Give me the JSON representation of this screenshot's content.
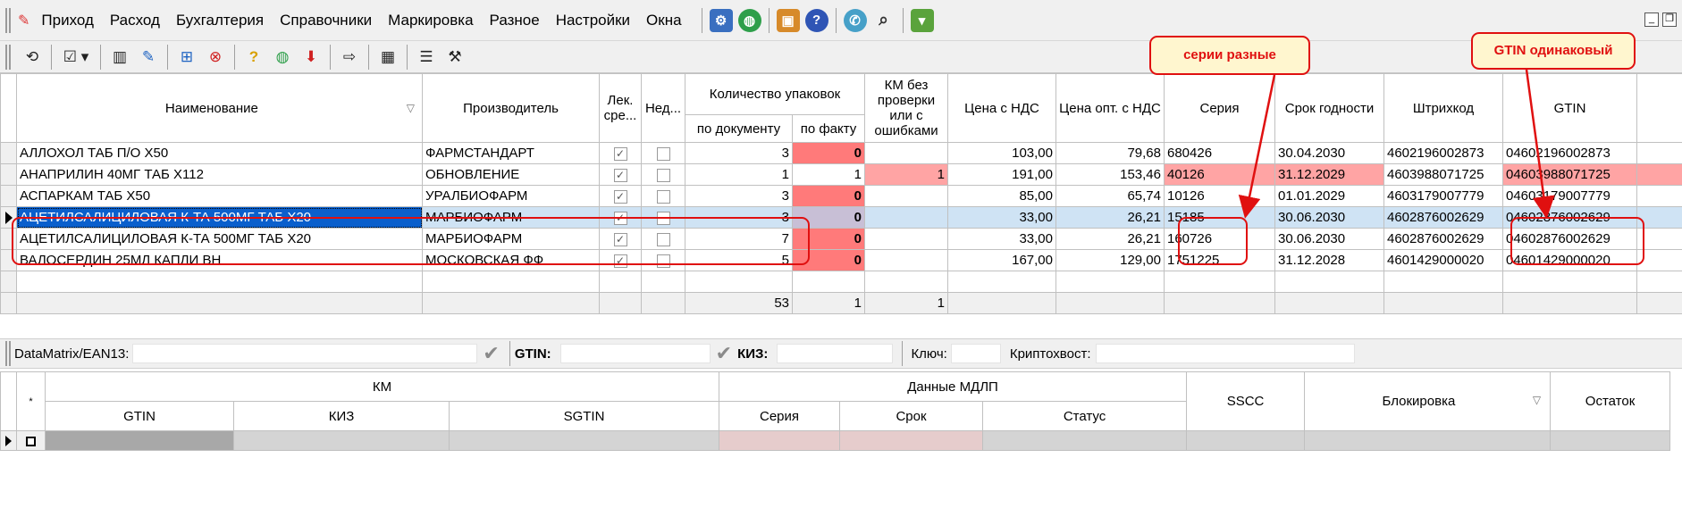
{
  "menu": [
    "Приход",
    "Расход",
    "Бухгалтерия",
    "Справочники",
    "Маркировка",
    "Разное",
    "Настройки",
    "Окна"
  ],
  "menu_icons": [
    "settings-icon",
    "globe-icon",
    "package-icon",
    "help-icon",
    "phone-icon",
    "magnifier-icon",
    "basket-icon"
  ],
  "toolbar_icons": [
    "refresh-icon",
    "checkbox-dropdown-icon",
    "barcode-icon",
    "edit-icon",
    "tree-add-icon",
    "cancel-icon",
    "question-icon",
    "globe-icon",
    "arrow-down-icon",
    "export-icon",
    "qr-icon",
    "list-icon",
    "tools-icon"
  ],
  "grid": {
    "headers": {
      "name": "Наименование",
      "maker": "Производитель",
      "lek": "Лек. сре...",
      "ned": "Нед...",
      "qty_group": "Количество упаковок",
      "qty_doc": "по документу",
      "qty_fact": "по факту",
      "km_unchecked": "КМ без проверки или с ошибками",
      "price_vat": "Цена с НДС",
      "price_wholesale": "Цена опт. с НДС",
      "series": "Серия",
      "expiry": "Срок годности",
      "barcode": "Штрихкод",
      "gtin": "GTIN"
    },
    "rows": [
      {
        "name": "АЛЛОХОЛ ТАБ П/О Х50",
        "maker": "ФАРМСТАНДАРТ",
        "doc": "3",
        "fact": "0",
        "km": "",
        "price": "103,00",
        "opt": "79,68",
        "series": "680426",
        "expiry": "30.04.2030",
        "barcode": "4602196002873",
        "gtin": "04602196002873"
      },
      {
        "name": "АНАПРИЛИН 40МГ ТАБ Х112",
        "maker": "ОБНОВЛЕНИЕ",
        "doc": "1",
        "fact": "1",
        "km": "1",
        "price": "191,00",
        "opt": "153,46",
        "series": "40126",
        "expiry": "31.12.2029",
        "barcode": "4603988071725",
        "gtin": "04603988071725"
      },
      {
        "name": "АСПАРКАМ ТАБ Х50",
        "maker": "УРАЛБИОФАРМ",
        "doc": "3",
        "fact": "0",
        "km": "",
        "price": "85,00",
        "opt": "65,74",
        "series": "10126",
        "expiry": "01.01.2029",
        "barcode": "4603179007779",
        "gtin": "04603179007779"
      },
      {
        "name": "АЦЕТИЛСАЛИЦИЛОВАЯ К-ТА 500МГ ТАБ Х20",
        "maker": "МАРБИОФАРМ",
        "doc": "3",
        "fact": "0",
        "km": "",
        "price": "33,00",
        "opt": "26,21",
        "series": "15185",
        "expiry": "30.06.2030",
        "barcode": "4602876002629",
        "gtin": "04602876002629"
      },
      {
        "name": "АЦЕТИЛСАЛИЦИЛОВАЯ К-ТА 500МГ ТАБ Х20",
        "maker": "МАРБИОФАРМ",
        "doc": "7",
        "fact": "0",
        "km": "",
        "price": "33,00",
        "opt": "26,21",
        "series": "160726",
        "expiry": "30.06.2030",
        "barcode": "4602876002629",
        "gtin": "04602876002629"
      },
      {
        "name": "ВАЛОСЕРДИН 25МЛ КАПЛИ ВН",
        "maker": "МОСКОВСКАЯ ФФ",
        "doc": "5",
        "fact": "0",
        "km": "",
        "price": "167,00",
        "opt": "129,00",
        "series": "1751225",
        "expiry": "31.12.2028",
        "barcode": "4601429000020",
        "gtin": "04601429000020"
      }
    ],
    "totals": {
      "doc": "53",
      "fact": "1",
      "km": "1"
    }
  },
  "filter": {
    "dm_label": "DataMatrix/EAN13:",
    "gtin_label": "GTIN:",
    "kiz_label": "КИЗ:",
    "key_label": "Ключ:",
    "crypto_label": "Криптохвост:"
  },
  "grid2": {
    "star": "*",
    "km_group": "КМ",
    "mdlp_group": "Данные МДЛП",
    "gtin": "GTIN",
    "kiz": "КИЗ",
    "sgtin": "SGTIN",
    "series": "Серия",
    "term": "Срок",
    "status": "Статус",
    "sscc": "SSCC",
    "block": "Блокировка",
    "rest": "Остаток"
  },
  "callouts": {
    "series": "серии разные",
    "gtin": "GTIN одинаковый"
  },
  "colors": {
    "red_cell": "#ff7a7a",
    "pink_cell": "#ffa4a4",
    "selection": "#0a5fcc",
    "annotation": "#e01010",
    "callout_bg": "#fff6cf"
  }
}
